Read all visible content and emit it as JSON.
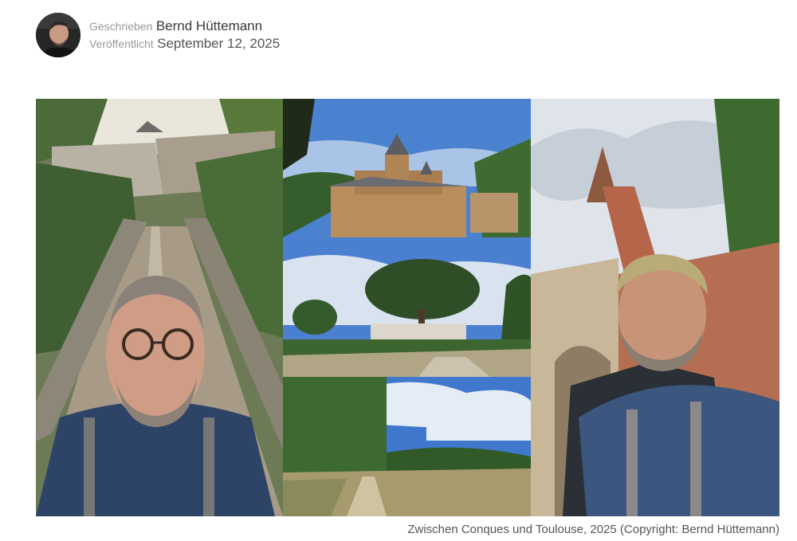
{
  "byline": {
    "written_label": "Geschrieben",
    "author": "Bernd Hüttemann",
    "published_label": "Veröffentlicht",
    "date": "September 12, 2025"
  },
  "figure": {
    "caption": "Zwischen Conques und Toulouse, 2025 (Copyright: Bernd Hüttemann)"
  },
  "colors": {
    "label_gray": "#9a9a9a",
    "value_gray": "#555555",
    "sky_blue": "#4a7fc9",
    "foliage_green": "#3f6b34",
    "brick": "#b5654a"
  }
}
